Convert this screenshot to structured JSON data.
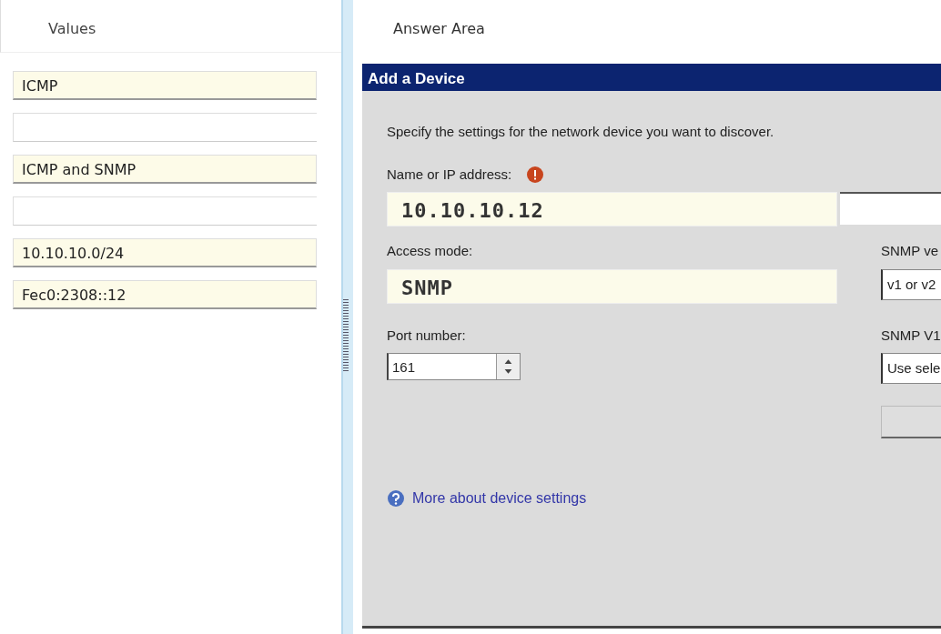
{
  "values_panel": {
    "heading": "Values",
    "slots": [
      {
        "kind": "value",
        "text": "ICMP"
      },
      {
        "kind": "empty"
      },
      {
        "kind": "value",
        "text": "ICMP and SNMP"
      },
      {
        "kind": "empty"
      },
      {
        "kind": "value",
        "text": "10.10.10.0/24"
      },
      {
        "kind": "value",
        "text": "Fec0:2308::12"
      }
    ]
  },
  "answer_area": {
    "heading": "Answer Area",
    "dialog": {
      "title": "Add a Device",
      "instruction": "Specify the settings for the network device you want to discover.",
      "name_label": "Name or IP address:",
      "name_answer": "10.10.10.12",
      "access_label": "Access mode:",
      "access_answer": "SNMP",
      "port_label": "Port number:",
      "port_value": "161",
      "snmp_version_label": "SNMP ve",
      "snmp_version_value": "v1 or v2",
      "snmp_v1_label": "SNMP V1",
      "snmp_v1_value": "Use sele",
      "side_button": {
        "disabled": true
      },
      "help_link": "More about device settings"
    }
  }
}
